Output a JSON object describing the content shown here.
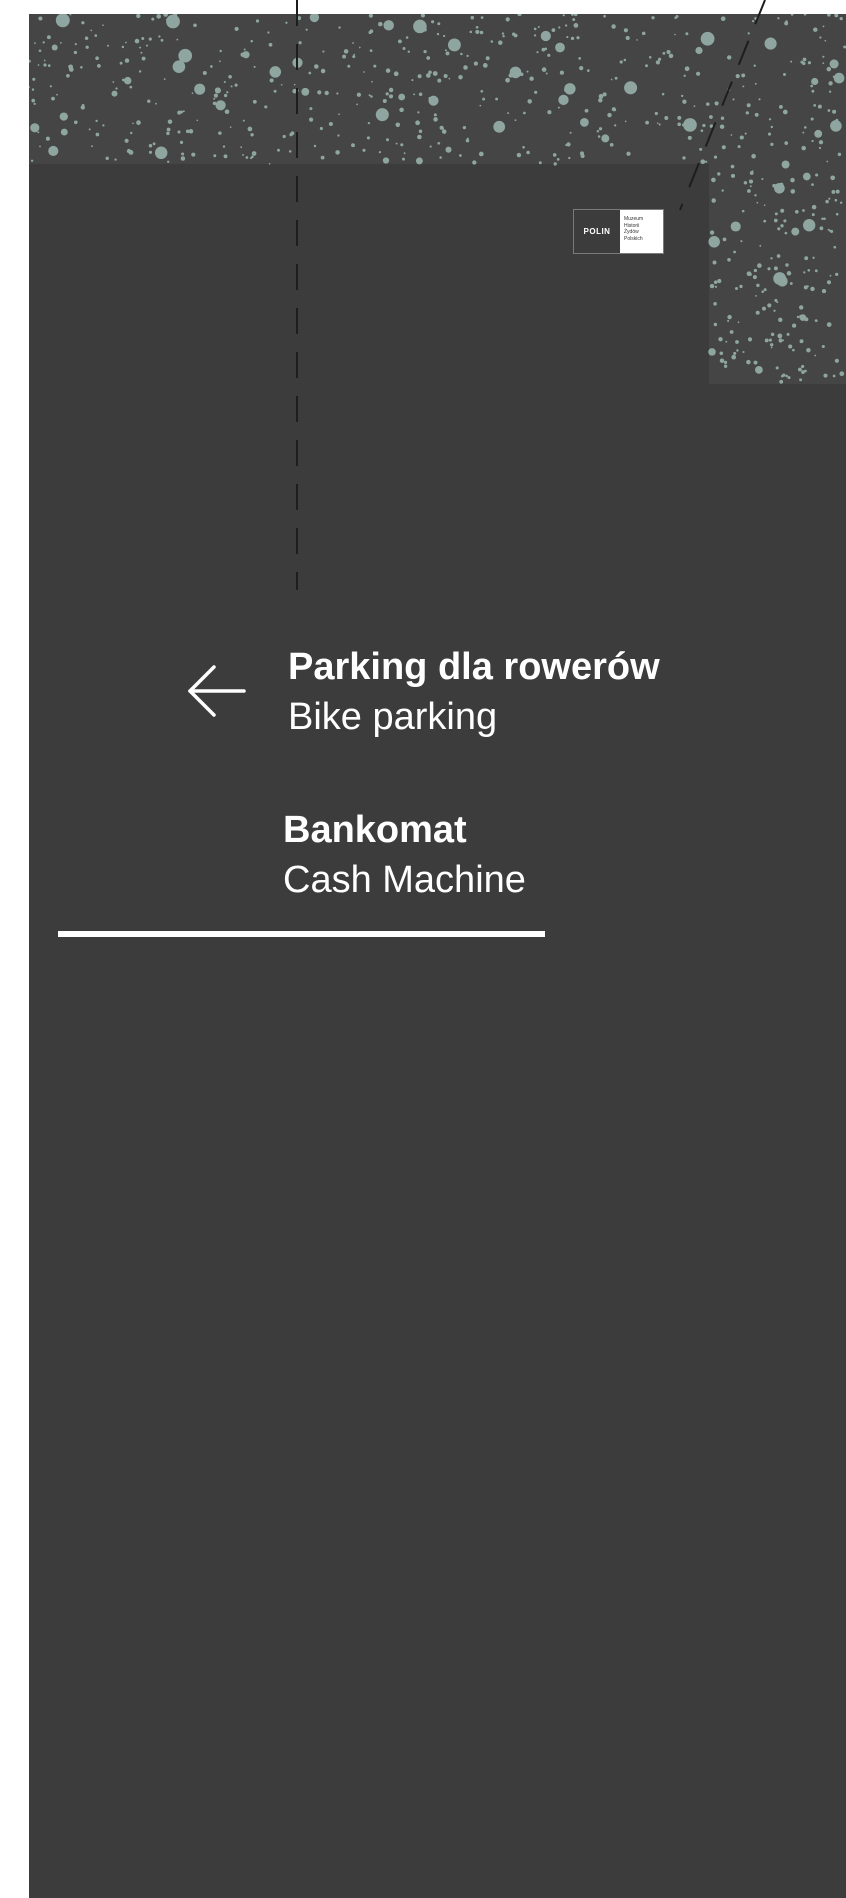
{
  "logo": {
    "mark": "POLIN",
    "caption_lines": [
      "Muzeum",
      "Historii",
      "Żydów",
      "Polskich"
    ]
  },
  "signs": [
    {
      "primary": "Parking dla rowerów",
      "secondary": "Bike parking",
      "arrow": "arrow-left-icon"
    },
    {
      "primary": "Bankomat",
      "secondary": "Cash Machine"
    }
  ],
  "colors": {
    "panel": "#3c3c3c",
    "speckle": "#8fa6a0",
    "text": "#ffffff"
  }
}
